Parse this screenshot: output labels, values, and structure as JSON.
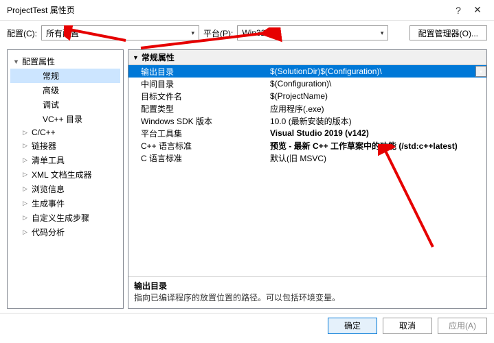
{
  "window": {
    "title": "ProjectTest 属性页"
  },
  "toolbar": {
    "config_label": "配置(C):",
    "config_value": "所有配置",
    "platform_label": "平台(P):",
    "platform_value": "Win32",
    "manager_button": "配置管理器(O)..."
  },
  "tree": [
    {
      "label": "配置属性",
      "indent": 0,
      "arrow": "▼"
    },
    {
      "label": "常规",
      "indent": 2,
      "selected": true
    },
    {
      "label": "高级",
      "indent": 2
    },
    {
      "label": "调试",
      "indent": 2
    },
    {
      "label": "VC++ 目录",
      "indent": 2
    },
    {
      "label": "C/C++",
      "indent": 1,
      "arrow": "▷"
    },
    {
      "label": "链接器",
      "indent": 1,
      "arrow": "▷"
    },
    {
      "label": "清单工具",
      "indent": 1,
      "arrow": "▷"
    },
    {
      "label": "XML 文档生成器",
      "indent": 1,
      "arrow": "▷"
    },
    {
      "label": "浏览信息",
      "indent": 1,
      "arrow": "▷"
    },
    {
      "label": "生成事件",
      "indent": 1,
      "arrow": "▷"
    },
    {
      "label": "自定义生成步骤",
      "indent": 1,
      "arrow": "▷"
    },
    {
      "label": "代码分析",
      "indent": 1,
      "arrow": "▷"
    }
  ],
  "grid": {
    "category": "常规属性",
    "rows": [
      {
        "label": "输出目录",
        "value": "$(SolutionDir)$(Configuration)\\",
        "selected": true,
        "dropdown": true
      },
      {
        "label": "中间目录",
        "value": "$(Configuration)\\"
      },
      {
        "label": "目标文件名",
        "value": "$(ProjectName)"
      },
      {
        "label": "配置类型",
        "value": "应用程序(.exe)"
      },
      {
        "label": "Windows SDK 版本",
        "value": "10.0 (最新安装的版本)"
      },
      {
        "label": "平台工具集",
        "value": "Visual Studio 2019 (v142)",
        "bold": true
      },
      {
        "label": "C++ 语言标准",
        "value": "预览 - 最新 C++ 工作草案中的功能 (/std:c++latest)",
        "bold": true
      },
      {
        "label": "C 语言标准",
        "value": "默认(旧 MSVC)"
      }
    ]
  },
  "description": {
    "title": "输出目录",
    "text": "指向已编译程序的放置位置的路径。可以包括环境变量。"
  },
  "footer": {
    "ok": "确定",
    "cancel": "取消",
    "apply": "应用(A)"
  }
}
